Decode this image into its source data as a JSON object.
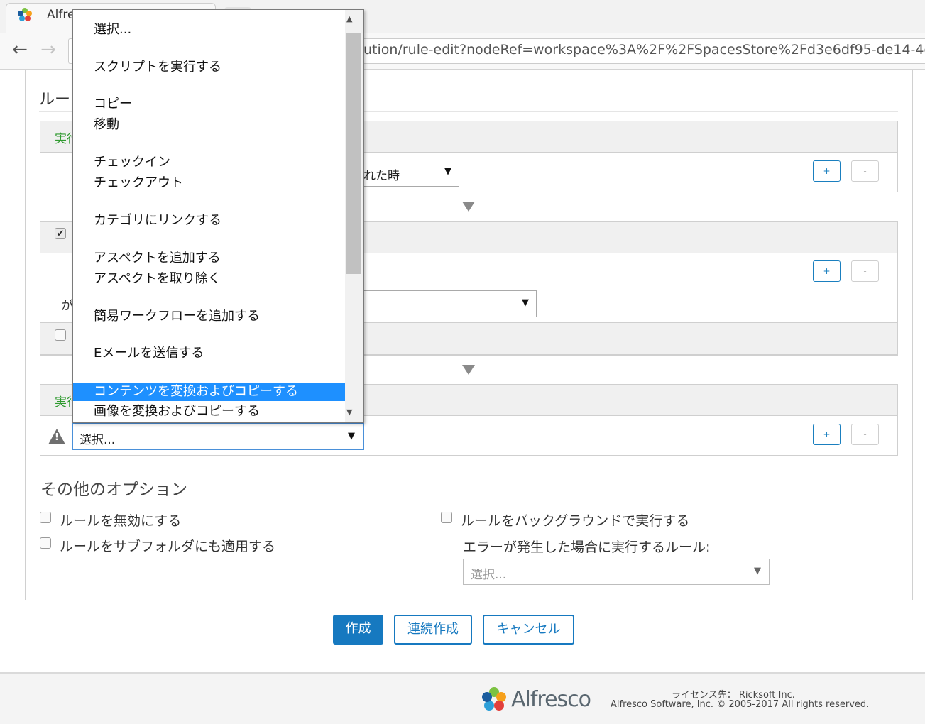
{
  "browser": {
    "tab_title": "Alfre",
    "url": "ution/rule-edit?nodeRef=workspace%3A%2F%2FSpacesStore%2Fd3e6df95-de14-4c5c",
    "back_icon": "←",
    "forward_icon": "→"
  },
  "rule": {
    "heading_visible": "ルー"
  },
  "sections": {
    "when": {
      "label": "実行",
      "select_value": "れた時"
    },
    "condition": {
      "ga_text": "が"
    },
    "action": {
      "label": "実行",
      "select_value": "選択..."
    }
  },
  "buttons": {
    "plus": "+",
    "minus": "-"
  },
  "other_options": {
    "heading": "その他のオプション",
    "disable_rule": "ルールを無効にする",
    "apply_subfolders": "ルールをサブフォルダにも適用する",
    "run_background": "ルールをバックグラウンドで実行する",
    "on_error_label": "エラーが発生した場合に実行するルール:",
    "on_error_placeholder": "選択..."
  },
  "actions": {
    "create": "作成",
    "create_continue": "連続作成",
    "cancel": "キャンセル"
  },
  "footer": {
    "logo_text": "Alfresco",
    "license": "ライセンス先： Ricksoft Inc.",
    "copyright": "Alfresco Software, Inc. © 2005-2017 All rights reserved."
  },
  "dropdown": {
    "selected_index": 12,
    "items": [
      "選択...",
      "スクリプトを実行する",
      "コピー",
      "移動",
      "チェックイン",
      "チェックアウト",
      "カテゴリにリンクする",
      "アスペクトを追加する",
      "アスペクトを取り除く",
      "簡易ワークフローを追加する",
      "Eメールを送信する",
      "",
      "コンテンツを変換およびコピーする",
      "画像を変換およびコピーする"
    ]
  },
  "colors": {
    "accent": "#1679c0",
    "green_label": "#2f9a2f",
    "selection": "#1e90ff"
  },
  "icons": {
    "caret": "▼",
    "scroll_up": "▲",
    "scroll_down": "▼",
    "check": "✔",
    "warning": "!"
  }
}
